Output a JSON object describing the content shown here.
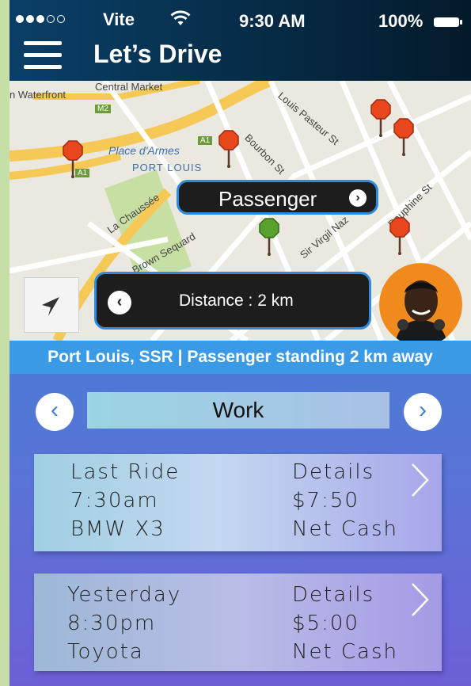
{
  "status_bar": {
    "carrier": "Vite",
    "time": "9:30 AM",
    "battery": "100%"
  },
  "header": {
    "title": "Let’s Drive"
  },
  "map": {
    "labels": {
      "waterfront": "n Waterfront",
      "central_market": "Central Market",
      "place_darmes": "Place d'Armes",
      "port_louis": "PORT LOUIS",
      "la_chaussee": "La Chaussée",
      "brown_sequard": "Brown Sequard",
      "louis_pasteur": "Louis Pasteur St",
      "bourbon": "Bourbon St",
      "sir_virgil": "Sir Virgil Naz",
      "dauphine": "Dauphine St",
      "m2": "M2",
      "a1a": "A1",
      "a1b": "A1"
    },
    "passenger_label": "Passenger",
    "distance_label": "Distance : 2 km",
    "colors": {
      "pin_red": "#e8461d",
      "pin_green": "#5aa02c"
    }
  },
  "banner": {
    "text": "Port Louis, SSR | Passenger standing 2 km away"
  },
  "category": {
    "selected": "Work"
  },
  "rides": [
    {
      "left": [
        "Last Ride",
        "7:30am",
        "BMW X3"
      ],
      "right": [
        "Details",
        "$7:50",
        "Net Cash"
      ]
    },
    {
      "left": [
        "Yesterday",
        "8:30pm",
        "Toyota"
      ],
      "right": [
        "Details",
        "$5:00",
        "Net Cash"
      ]
    }
  ]
}
